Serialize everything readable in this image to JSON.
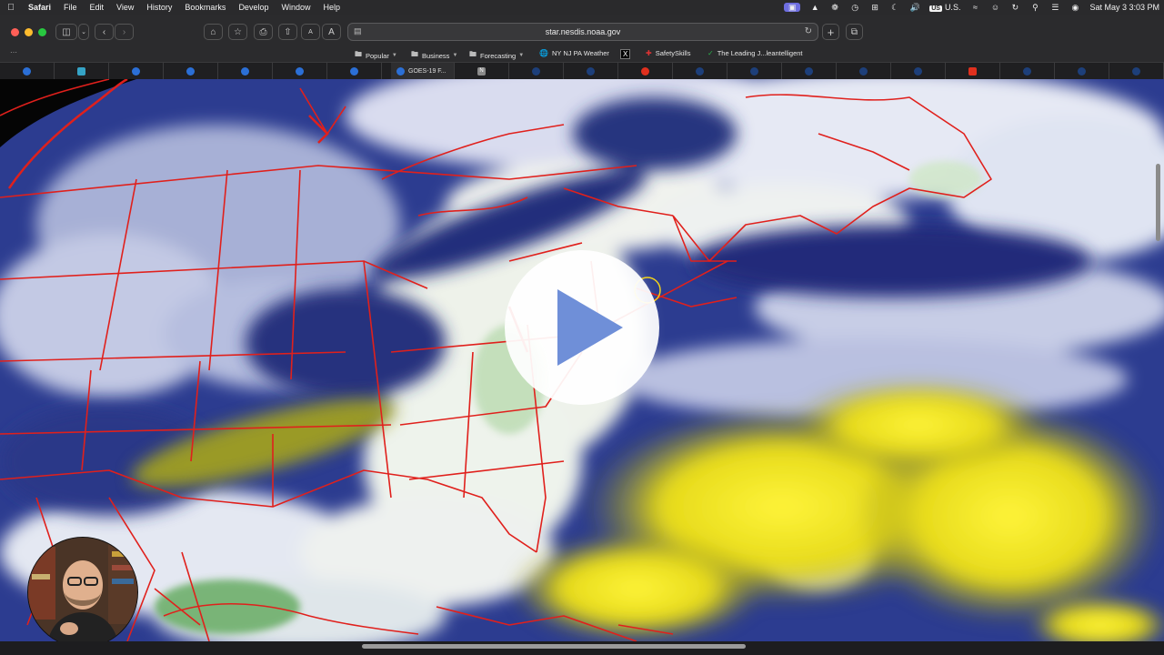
{
  "menubar": {
    "app": "Safari",
    "items": [
      "File",
      "Edit",
      "View",
      "History",
      "Bookmarks",
      "Develop",
      "Window",
      "Help"
    ],
    "input_source": "U.S.",
    "input_badge": "US",
    "clock": "Sat May 3  3:03 PM"
  },
  "toolbar": {
    "url": "star.nesdis.noaa.gov",
    "text_small": "A",
    "text_large": "A"
  },
  "favorites": [
    {
      "label": "Popular",
      "icon": "folder-icon",
      "menu": true
    },
    {
      "label": "Business",
      "icon": "folder-icon",
      "menu": true
    },
    {
      "label": "Forecasting",
      "icon": "folder-icon",
      "menu": true
    },
    {
      "label": "NY NJ PA Weather",
      "icon": "globe-icon",
      "menu": false
    },
    {
      "label": "",
      "icon": "x-icon",
      "menu": false
    },
    {
      "label": "SafetySkills",
      "icon": "safety-icon",
      "menu": false
    },
    {
      "label": "The Leading J...leantelligent",
      "icon": "check-icon",
      "menu": false
    }
  ],
  "tabs": {
    "active_label": "GOES-19 F..."
  },
  "colors": {
    "menubar_bg": "#2a2a2c",
    "chrome_bg": "#2b2b2d",
    "tabbar_bg": "#1f1f21",
    "close": "#ff5f57",
    "minimize": "#febc2e",
    "zoom": "#28c840",
    "borders": "#e0201c",
    "water_vapor_dry": "#2a3a8e",
    "water_vapor_moist": "#e9ecf5",
    "high_level_dry": "#e8e21a"
  }
}
